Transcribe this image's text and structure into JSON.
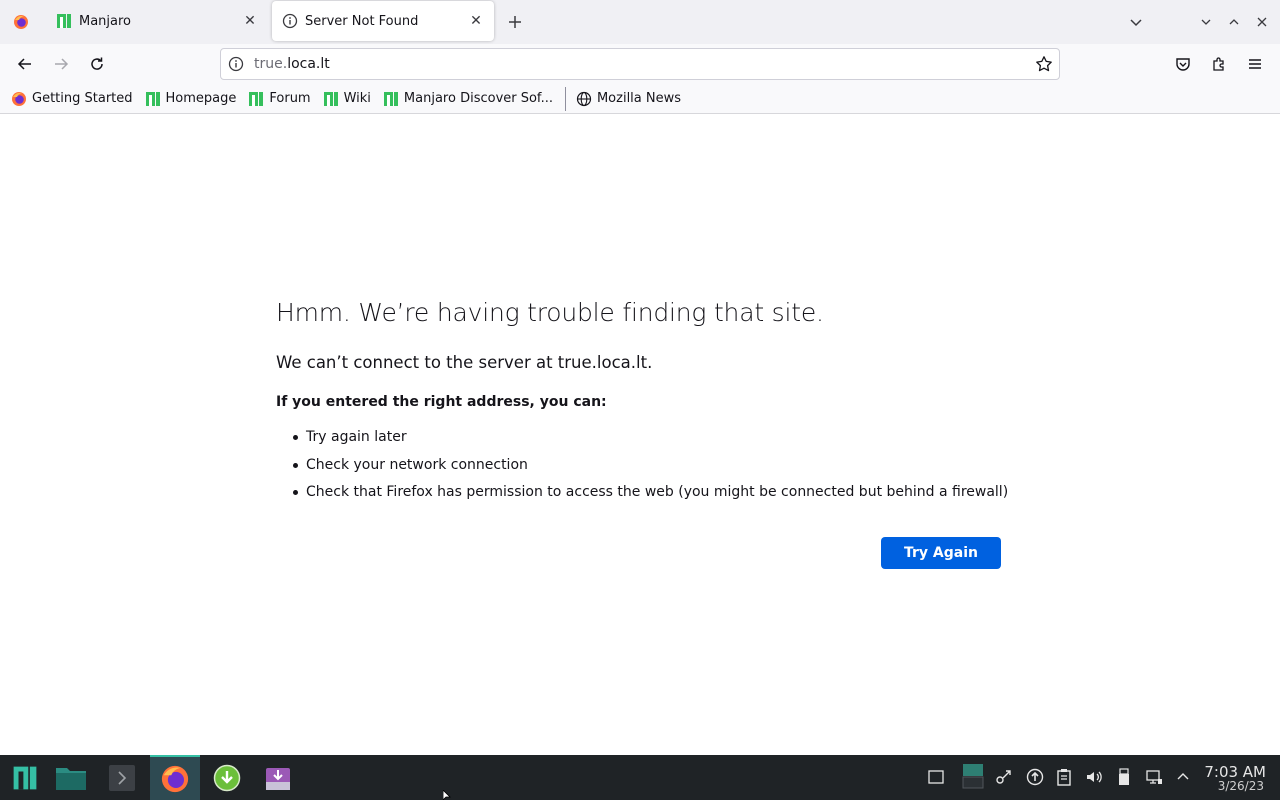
{
  "browser": {
    "tabs": [
      {
        "title": "Manjaro",
        "icon": "manjaro-icon"
      },
      {
        "title": "Server Not Found",
        "icon": "info-icon"
      }
    ],
    "url": {
      "host_prefix": "true.",
      "host_domain": "loca.lt"
    },
    "bookmarks": [
      {
        "label": "Getting Started",
        "icon": "firefox-icon"
      },
      {
        "label": "Homepage",
        "icon": "manjaro-icon"
      },
      {
        "label": "Forum",
        "icon": "manjaro-icon"
      },
      {
        "label": "Wiki",
        "icon": "manjaro-icon"
      },
      {
        "label": "Manjaro Discover Sof...",
        "icon": "manjaro-icon"
      },
      {
        "label": "Mozilla News",
        "icon": "globe-icon"
      }
    ]
  },
  "error_page": {
    "title": "Hmm. We’re having trouble finding that site.",
    "description": "We can’t connect to the server at true.loca.lt.",
    "subtitle": "If you entered the right address, you can:",
    "suggestions": [
      "Try again later",
      "Check your network connection",
      "Check that Firefox has permission to access the web (you might be connected but behind a firewall)"
    ],
    "button_label": "Try Again"
  },
  "taskbar": {
    "time": "7:03 AM",
    "date": "3/26/23"
  },
  "colors": {
    "accent": "#0061e0",
    "manjaro_green": "#35bf5c",
    "taskbar_bg": "#1f2326"
  }
}
